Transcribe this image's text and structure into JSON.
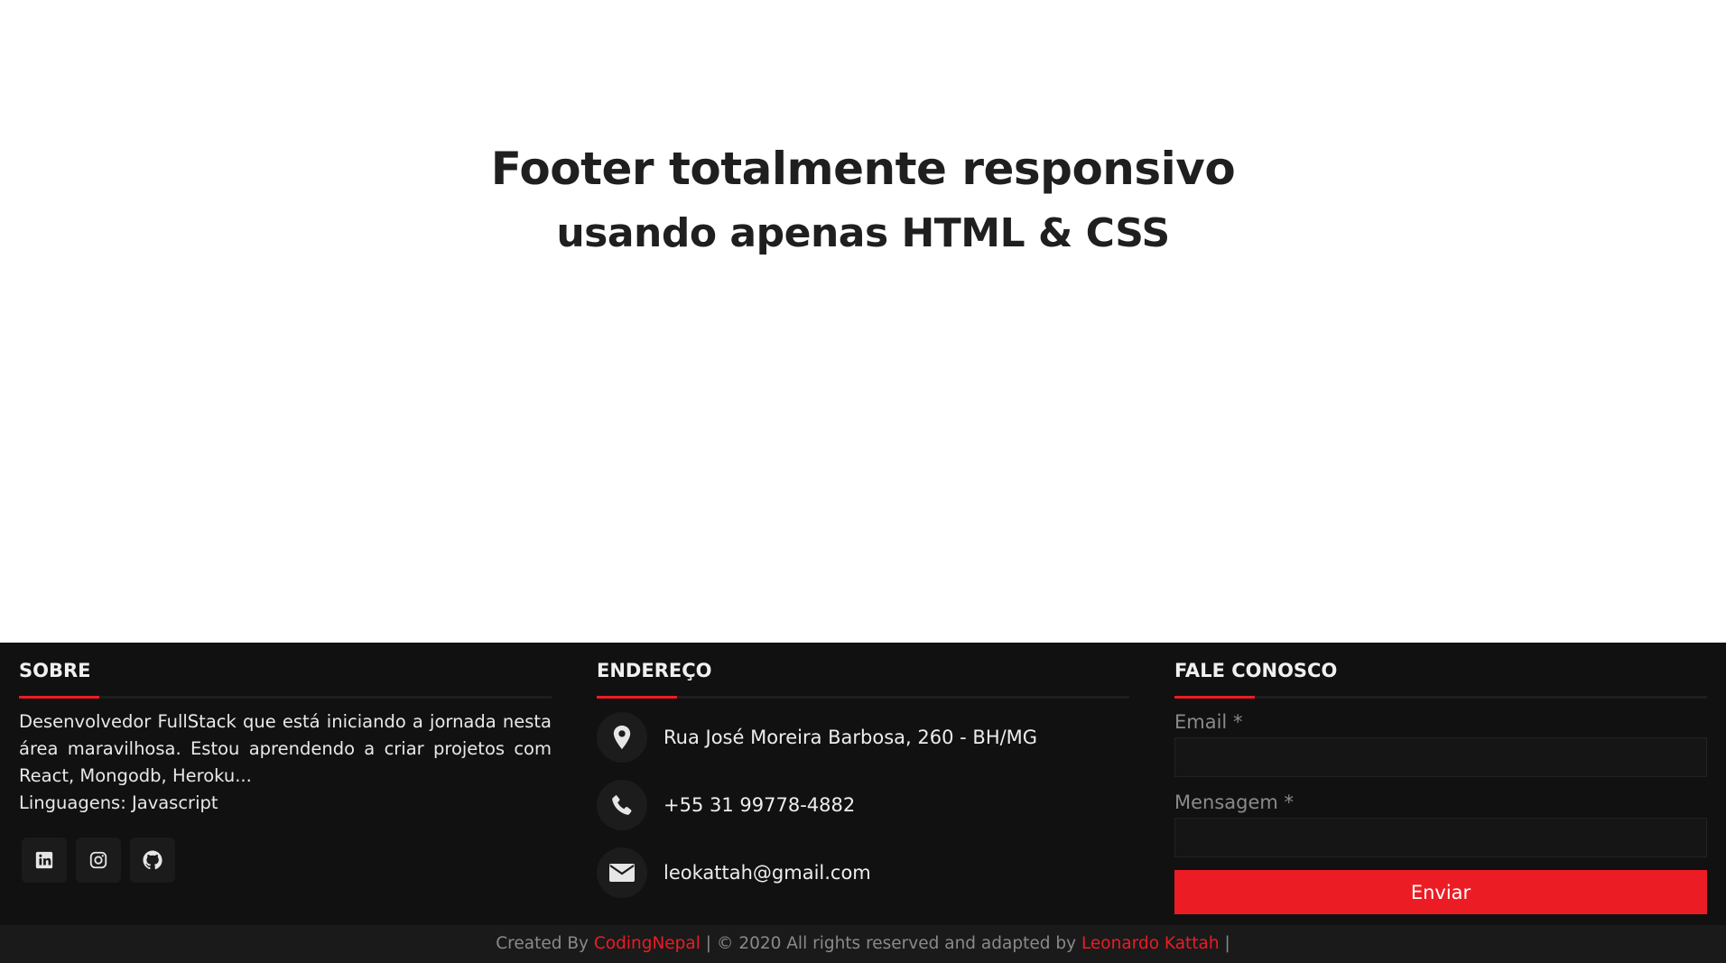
{
  "hero": {
    "title": "Footer totalmente responsivo",
    "subtitle": "usando apenas HTML & CSS"
  },
  "footer": {
    "about": {
      "title": "SOBRE",
      "text": "Desenvolvedor FullStack que está iniciando a jornada nesta área maravilhosa. Estou aprendendo a criar projetos com React, Mongodb, Heroku...",
      "languages": "Linguagens: Javascript",
      "social": [
        {
          "icon": "linkedin-icon"
        },
        {
          "icon": "instagram-icon"
        },
        {
          "icon": "github-icon"
        }
      ]
    },
    "address": {
      "title": "ENDEREÇO",
      "items": [
        {
          "icon": "map-marker-icon",
          "text": "Rua José Moreira Barbosa, 260 - BH/MG"
        },
        {
          "icon": "phone-icon",
          "text": "+55 31 99778-4882"
        },
        {
          "icon": "envelope-icon",
          "text": "leokattah@gmail.com"
        }
      ]
    },
    "contact": {
      "title": "FALE CONOSCO",
      "email_label": "Email *",
      "email_value": "",
      "message_label": "Mensagem *",
      "message_value": "",
      "submit_label": "Enviar"
    },
    "bottom": {
      "created_by": "Created By",
      "author_link": "CodingNepal",
      "separator1": "|",
      "copyright_symbol": "©",
      "rights_text": "2020 All rights reserved and adapted by",
      "adapter_link": "Leonardo Kattah",
      "separator2": "|"
    }
  },
  "colors": {
    "accent": "#ec1c24",
    "footer_bg": "#111111",
    "bottom_bg": "#1a1a1a",
    "hero_text": "#1f1f1f"
  }
}
